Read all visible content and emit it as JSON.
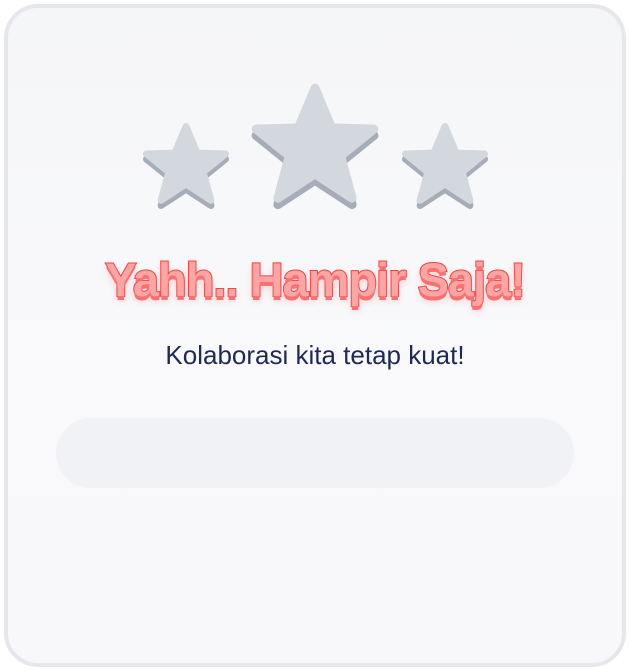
{
  "result": {
    "title": "Yahh.. Hampir Saja!",
    "subtitle": "Kolaborasi kita tetap kuat!"
  },
  "rating": {
    "earned": 0,
    "total": 3
  },
  "colors": {
    "star_empty": "#d1d5db",
    "title_fill": "#fca5a5",
    "title_stroke": "#ef4444",
    "subtitle": "#1e2a52",
    "card_border": "#e5e7eb"
  }
}
